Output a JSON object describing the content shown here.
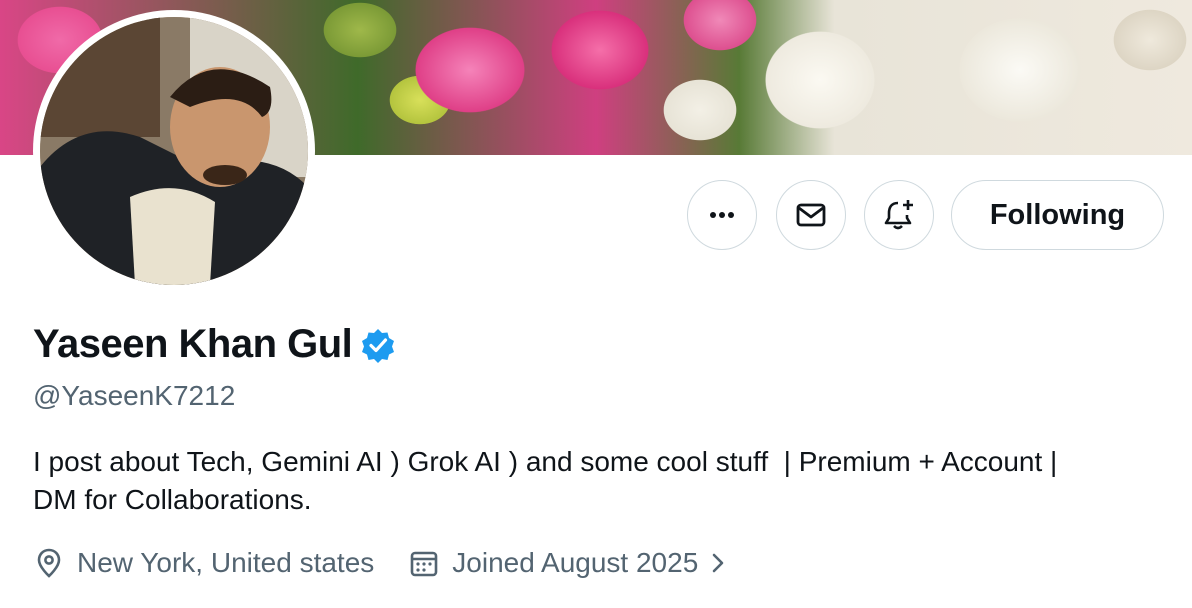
{
  "profile": {
    "name": "Yaseen Khan Gul",
    "handle": "@YaseenK7212",
    "bio_line1": "I post about Tech, Gemini AI ) Grok AI ) and some cool stuff  | Premium + Account |",
    "bio_line2": "DM for Collaborations.",
    "location": "New York, United states",
    "joined": "Joined August 2025",
    "verified": true
  },
  "actions": {
    "more_icon": "more-horizontal-icon",
    "message_icon": "envelope-icon",
    "notify_icon": "bell-plus-icon",
    "follow_label": "Following"
  },
  "colors": {
    "verified_blue": "#1d9bf0",
    "secondary_text": "#536471",
    "border": "#cfd9de"
  }
}
